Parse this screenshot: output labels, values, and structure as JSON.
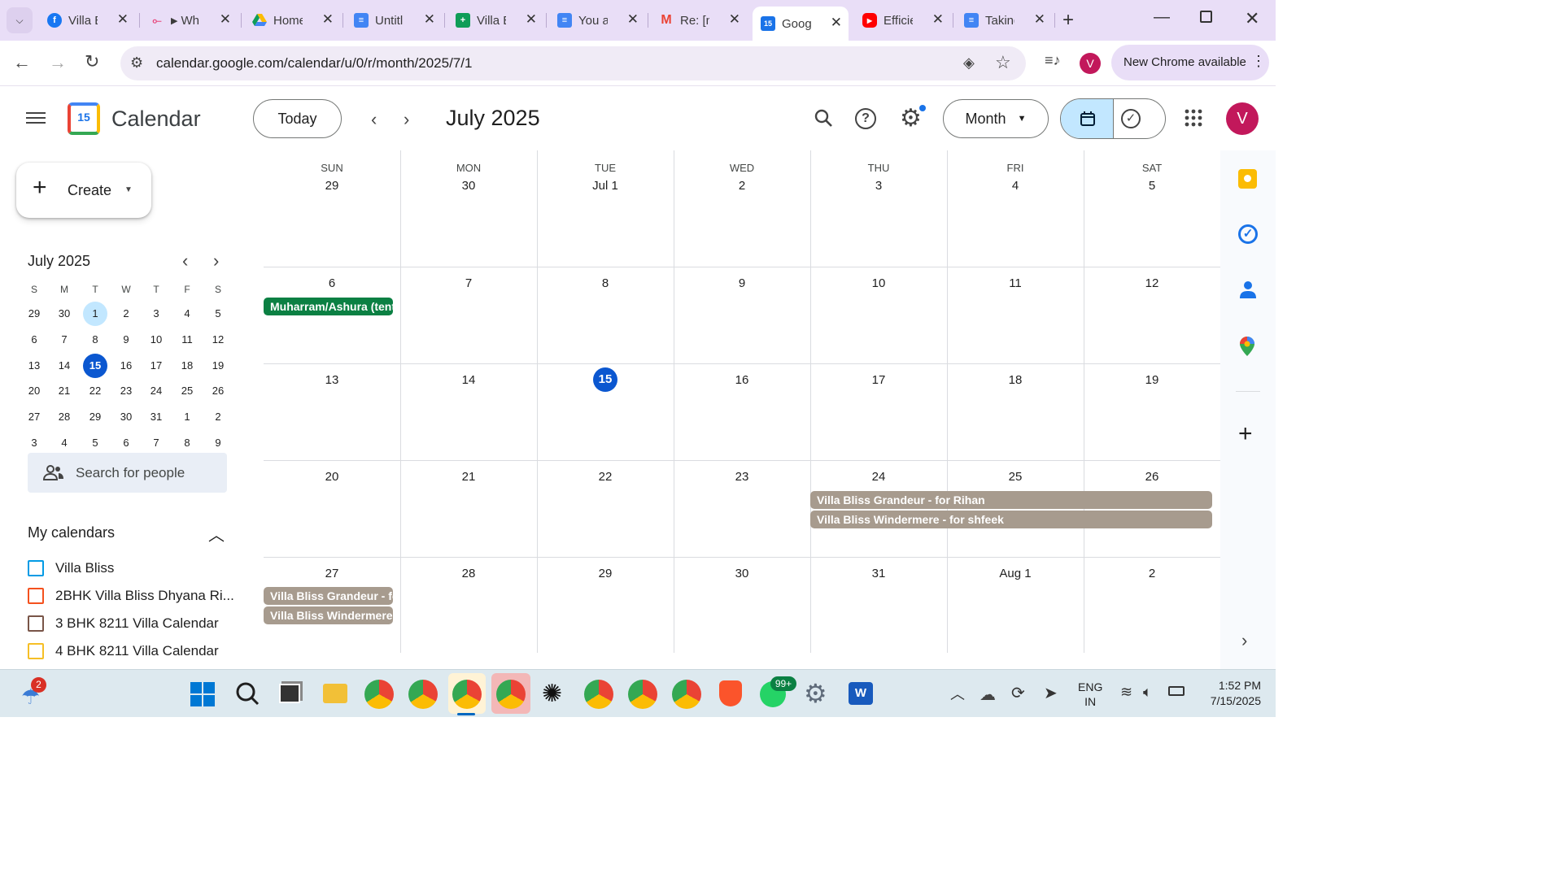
{
  "browser": {
    "tabs": [
      {
        "title": "Villa B",
        "favicon": "facebook-icon",
        "color": "#1877f2"
      },
      {
        "title": "Wh",
        "favicon": "flow-icon",
        "color": "#e8457a"
      },
      {
        "title": "Home",
        "favicon": "drive-icon",
        "color": "#fbbc04"
      },
      {
        "title": "Untitl",
        "favicon": "docs-icon",
        "color": "#4285f4"
      },
      {
        "title": "Villa B",
        "favicon": "sheets-icon",
        "color": "#0f9d58"
      },
      {
        "title": "You a",
        "favicon": "docs-icon",
        "color": "#4285f4"
      },
      {
        "title": "Re: [n",
        "favicon": "gmail-icon",
        "color": "#ea4335"
      },
      {
        "title": "Googl",
        "favicon": "calendar-icon",
        "color": "#1a73e8"
      },
      {
        "title": "Efficie",
        "favicon": "youtube-icon",
        "color": "#ff0000"
      },
      {
        "title": "Taking",
        "favicon": "docs-icon",
        "color": "#4285f4"
      }
    ],
    "url": "calendar.google.com/calendar/u/0/r/month/2025/7/1",
    "profile_initial": "V",
    "new_chrome": "New Chrome available"
  },
  "header": {
    "app_name": "Calendar",
    "logo_day": "15",
    "today_label": "Today",
    "period": "July 2025",
    "view_label": "Month",
    "avatar_initial": "V"
  },
  "sidebar": {
    "create_label": "Create",
    "mini_month": "July 2025",
    "weekday_heads": [
      "S",
      "M",
      "T",
      "W",
      "T",
      "F",
      "S"
    ],
    "weeks": [
      [
        "29",
        "30",
        "1",
        "2",
        "3",
        "4",
        "5"
      ],
      [
        "6",
        "7",
        "8",
        "9",
        "10",
        "11",
        "12"
      ],
      [
        "13",
        "14",
        "15",
        "16",
        "17",
        "18",
        "19"
      ],
      [
        "20",
        "21",
        "22",
        "23",
        "24",
        "25",
        "26"
      ],
      [
        "27",
        "28",
        "29",
        "30",
        "31",
        "1",
        "2"
      ],
      [
        "3",
        "4",
        "5",
        "6",
        "7",
        "8",
        "9"
      ]
    ],
    "search_people": "Search for people",
    "my_calendars_title": "My calendars",
    "calendars": [
      {
        "name": "Villa Bliss",
        "color": "#039be5"
      },
      {
        "name": "2BHK Villa Bliss Dhyana Ri...",
        "color": "#f4511e"
      },
      {
        "name": "3 BHK 8211 Villa Calendar",
        "color": "#795548"
      },
      {
        "name": "4 BHK 8211 Villa Calendar",
        "color": "#f6bf26"
      }
    ]
  },
  "month": {
    "dow": [
      "SUN",
      "MON",
      "TUE",
      "WED",
      "THU",
      "FRI",
      "SAT"
    ],
    "weeks": [
      [
        "29",
        "30",
        "Jul 1",
        "2",
        "3",
        "4",
        "5"
      ],
      [
        "6",
        "7",
        "8",
        "9",
        "10",
        "11",
        "12"
      ],
      [
        "13",
        "14",
        "15",
        "16",
        "17",
        "18",
        "19"
      ],
      [
        "20",
        "21",
        "22",
        "23",
        "24",
        "25",
        "26"
      ],
      [
        "27",
        "28",
        "29",
        "30",
        "31",
        "Aug 1",
        "2"
      ]
    ],
    "today": "15",
    "events": {
      "holiday": "Muharram/Ashura (tentative)",
      "grandeur": "Villa Bliss Grandeur - for Rihan",
      "windermere": "Villa Bliss Windermere - for shfeek",
      "grandeur_short": "Villa Bliss Grandeur - for Rihan",
      "windermere_short": "Villa Bliss Windermere - for shfeek"
    },
    "colors": {
      "holiday": "#0b8043",
      "booking": "#a79b8e",
      "today": "#0b57d0"
    }
  },
  "taskbar": {
    "time": "1:52 PM",
    "date": "7/15/2025",
    "lang1": "ENG",
    "lang2": "IN",
    "whatsapp_badge": "99+",
    "weather_badge": "2"
  }
}
